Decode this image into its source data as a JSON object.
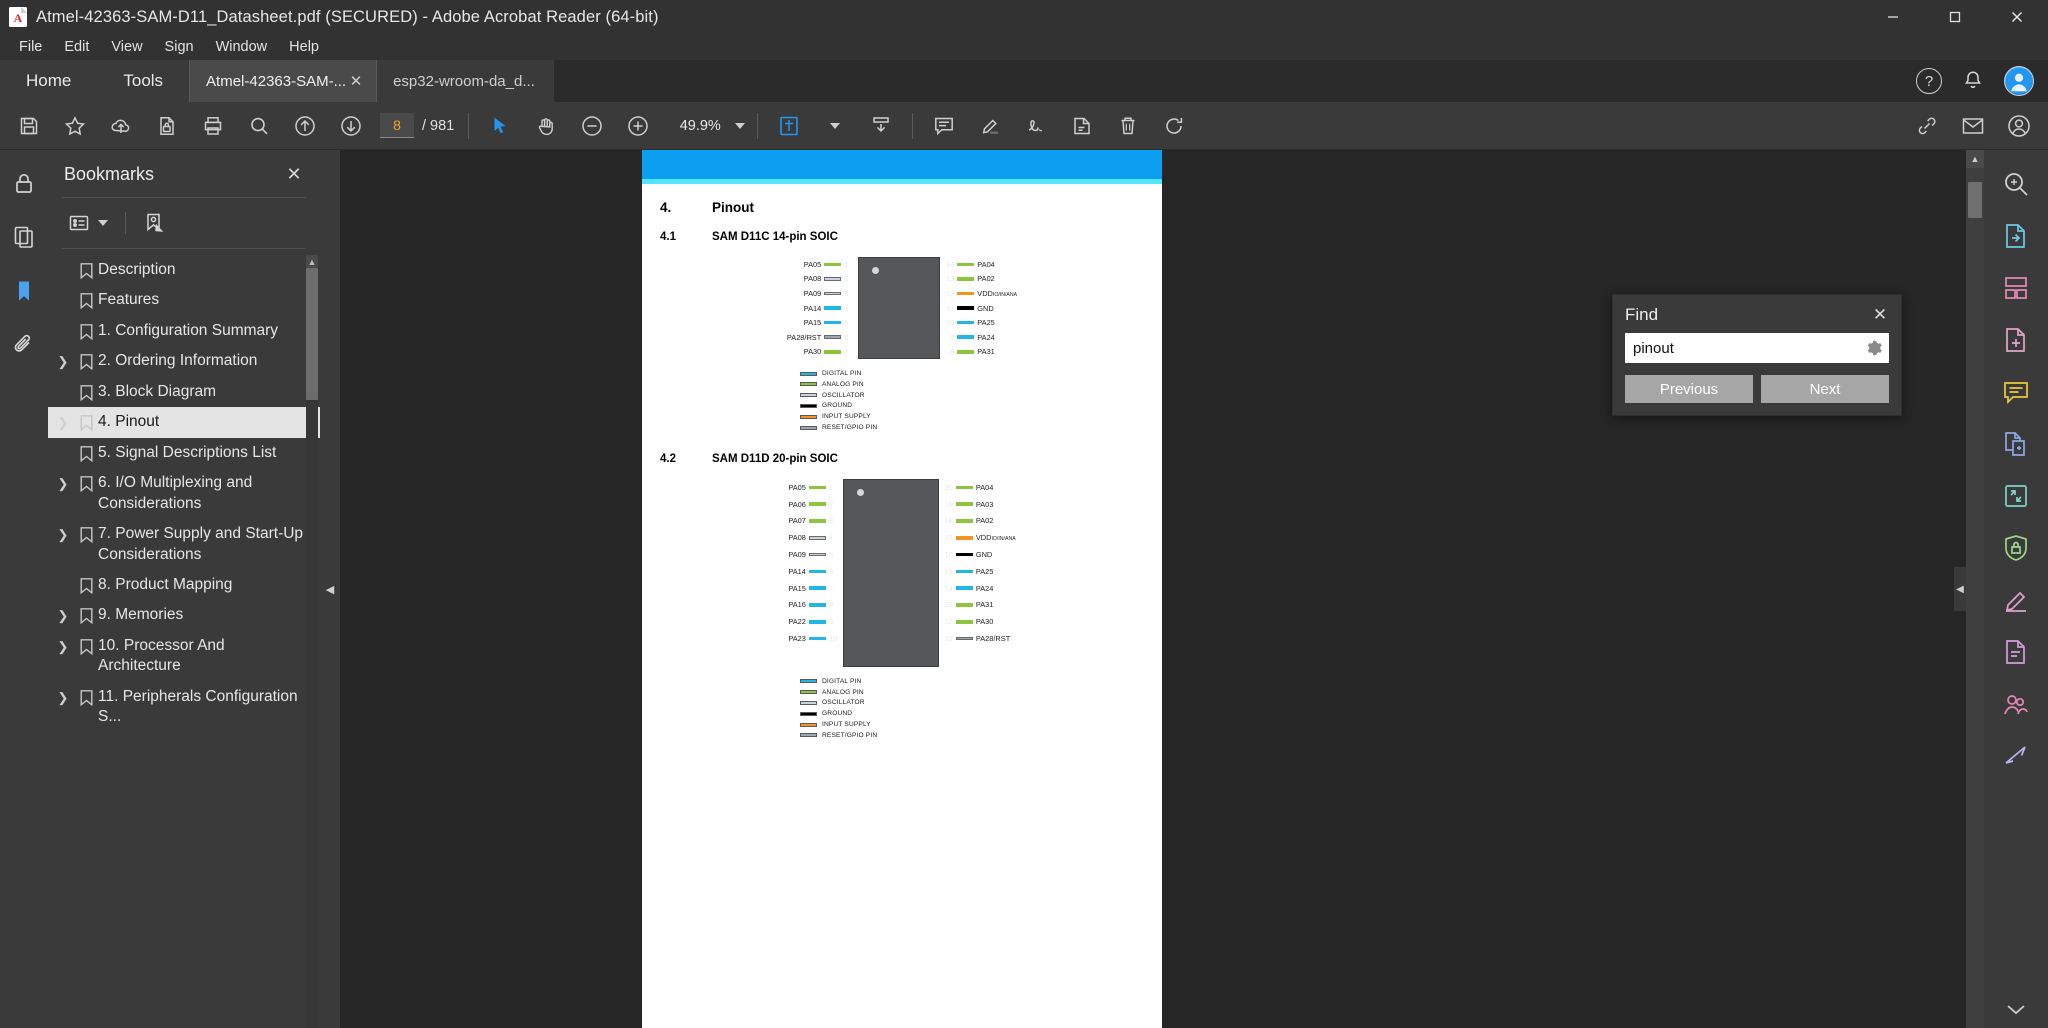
{
  "window": {
    "title": "Atmel-42363-SAM-D11_Datasheet.pdf (SECURED) - Adobe Acrobat Reader (64-bit)",
    "minimize": "–",
    "maximize": "□",
    "close": "✕"
  },
  "menu": {
    "items": [
      "File",
      "Edit",
      "View",
      "Sign",
      "Window",
      "Help"
    ]
  },
  "tabs": {
    "home_label": "Home",
    "tools_label": "Tools",
    "documents": [
      {
        "label": "Atmel-42363-SAM-...",
        "close": "✕",
        "active": true
      },
      {
        "label": "esp32-wroom-da_d...",
        "close": "",
        "active": false
      }
    ],
    "help_icon": "?",
    "bell_icon": "notification-bell"
  },
  "toolbar": {
    "page_value": "8",
    "page_total": "/ 981",
    "zoom_value": "49.9%",
    "icons": [
      "save-icon",
      "star-icon",
      "cloud-upload-icon",
      "secure-doc-icon",
      "print-icon",
      "search-icon",
      "previous-page-icon",
      "next-page-icon",
      "select-tool-icon",
      "hand-tool-icon",
      "zoom-out-icon",
      "zoom-in-icon",
      "fit-page-icon",
      "scroll-mode-icon",
      "comment-icon",
      "highlight-icon",
      "sign-icon",
      "stamp-icon",
      "delete-icon",
      "rotate-icon",
      "link-icon",
      "email-icon",
      "account-icon"
    ]
  },
  "left_rail": {
    "items": [
      "lock-icon",
      "page-thumbnails-icon",
      "bookmarks-icon",
      "attachments-icon"
    ]
  },
  "bookmarks_panel": {
    "title": "Bookmarks",
    "close": "✕",
    "options_icon": "bookmark-options-icon",
    "caret_icon": "chevron-down-icon",
    "new_bookmark_icon": "new-bookmark-icon",
    "items": [
      {
        "label": "Description",
        "expandable": false,
        "active": false
      },
      {
        "label": "Features",
        "expandable": false,
        "active": false
      },
      {
        "label": "1. Configuration Summary",
        "expandable": false,
        "active": false
      },
      {
        "label": "2. Ordering Information",
        "expandable": true,
        "active": false
      },
      {
        "label": "3. Block Diagram",
        "expandable": false,
        "active": false
      },
      {
        "label": "4. Pinout",
        "expandable": true,
        "active": true
      },
      {
        "label": "5. Signal Descriptions List",
        "expandable": false,
        "active": false
      },
      {
        "label": "6. I/O Multiplexing and Considerations",
        "expandable": true,
        "active": false
      },
      {
        "label": "7. Power Supply and Start-Up Considerations",
        "expandable": true,
        "active": false
      },
      {
        "label": "8. Product Mapping",
        "expandable": false,
        "active": false
      },
      {
        "label": "9. Memories",
        "expandable": true,
        "active": false
      },
      {
        "label": "10. Processor And Architecture",
        "expandable": true,
        "active": false
      },
      {
        "label": "11. Peripherals Configuration S...",
        "expandable": true,
        "active": false
      }
    ]
  },
  "find_panel": {
    "title": "Find",
    "close": "✕",
    "query": "pinout",
    "placeholder": "Find",
    "settings_icon": "gear-icon",
    "previous_label": "Previous",
    "next_label": "Next"
  },
  "document": {
    "heading_num": "4.",
    "heading_text": "Pinout",
    "sections": [
      {
        "num": "4.1",
        "title": "SAM D11C 14-pin SOIC",
        "left_pins": [
          {
            "num": "1",
            "name": "PA05",
            "color": "#8cc63e"
          },
          {
            "num": "2",
            "name": "PA08",
            "color": "#c8d4e4"
          },
          {
            "num": "3",
            "name": "PA09",
            "color": "#c8d4e4"
          },
          {
            "num": "4",
            "name": "PA14",
            "color": "#22b5e8"
          },
          {
            "num": "5",
            "name": "PA15",
            "color": "#22b5e8"
          },
          {
            "num": "6",
            "name": "PA28/RST",
            "color": "#9aa7b5"
          },
          {
            "num": "7",
            "name": "PA30",
            "color": "#8cc63e"
          }
        ],
        "right_pins": [
          {
            "num": "14",
            "name": "PA04",
            "color": "#8cc63e"
          },
          {
            "num": "13",
            "name": "PA02",
            "color": "#8cc63e"
          },
          {
            "num": "12",
            "name": "VDD",
            "sub": "IO/IN/ANA",
            "color": "#f7941e"
          },
          {
            "num": "11",
            "name": "GND",
            "color": "#000000"
          },
          {
            "num": "10",
            "name": "PA25",
            "color": "#22b5e8"
          },
          {
            "num": "9",
            "name": "PA24",
            "color": "#22b5e8"
          },
          {
            "num": "8",
            "name": "PA31",
            "color": "#8cc63e"
          }
        ]
      },
      {
        "num": "4.2",
        "title": "SAM D11D 20-pin SOIC",
        "left_pins": [
          {
            "num": "1",
            "name": "PA05",
            "color": "#8cc63e"
          },
          {
            "num": "2",
            "name": "PA06",
            "color": "#8cc63e"
          },
          {
            "num": "3",
            "name": "PA07",
            "color": "#8cc63e"
          },
          {
            "num": "4",
            "name": "PA08",
            "color": "#c8d4e4"
          },
          {
            "num": "5",
            "name": "PA09",
            "color": "#c8d4e4"
          },
          {
            "num": "6",
            "name": "PA14",
            "color": "#22b5e8"
          },
          {
            "num": "7",
            "name": "PA15",
            "color": "#22b5e8"
          },
          {
            "num": "8",
            "name": "PA16",
            "color": "#22b5e8"
          },
          {
            "num": "9",
            "name": "PA22",
            "color": "#22b5e8"
          },
          {
            "num": "10",
            "name": "PA23",
            "color": "#22b5e8"
          }
        ],
        "right_pins": [
          {
            "num": "20",
            "name": "PA04",
            "color": "#8cc63e"
          },
          {
            "num": "19",
            "name": "PA03",
            "color": "#8cc63e"
          },
          {
            "num": "18",
            "name": "PA02",
            "color": "#8cc63e"
          },
          {
            "num": "17",
            "name": "VDD",
            "sub": "IO/IN/ANA",
            "color": "#f7941e"
          },
          {
            "num": "16",
            "name": "GND",
            "color": "#000000"
          },
          {
            "num": "15",
            "name": "PA25",
            "color": "#22b5e8"
          },
          {
            "num": "14",
            "name": "PA24",
            "color": "#22b5e8"
          },
          {
            "num": "13",
            "name": "PA31",
            "color": "#8cc63e"
          },
          {
            "num": "12",
            "name": "PA30",
            "color": "#8cc63e"
          },
          {
            "num": "11",
            "name": "PA28/RST",
            "color": "#9aa7b5"
          }
        ]
      }
    ],
    "legend": [
      {
        "label": "DIGITAL PIN",
        "color": "#22b5e8"
      },
      {
        "label": "ANALOG PIN",
        "color": "#8cc63e"
      },
      {
        "label": "OSCILLATOR",
        "color": "#c8d4e4"
      },
      {
        "label": "GROUND",
        "color": "#000000"
      },
      {
        "label": "INPUT SUPPLY",
        "color": "#f7941e"
      },
      {
        "label": "RESET/GPIO PIN",
        "color": "#9aa7b5"
      }
    ]
  },
  "right_rail": {
    "items": [
      "search-enhanced-icon",
      "export-pdf-icon",
      "organize-pages-icon",
      "create-pdf-icon",
      "comment-panel-icon",
      "combine-files-icon",
      "compress-pdf-icon",
      "protect-icon",
      "fill-sign-icon",
      "edit-pdf-icon",
      "scan-ocr-icon",
      "share-icon",
      "more-tools-icon"
    ]
  },
  "colors": {
    "accent": "#0c9ef0",
    "chrome": "#3a3a3a",
    "titlebar": "#323232",
    "highlight": "#e4e4e4"
  }
}
